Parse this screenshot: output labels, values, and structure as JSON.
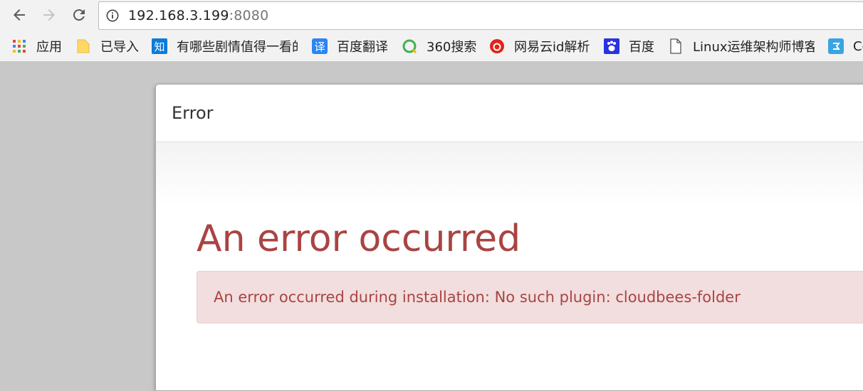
{
  "browser": {
    "url_host": "192.168.3.199",
    "url_port": ":8080",
    "bookmarks": [
      {
        "icon": "apps-grid-icon",
        "label": "应用"
      },
      {
        "icon": "folder-icon",
        "label": "已导入"
      },
      {
        "icon": "zhihu-icon",
        "label": "有哪些剧情值得一看的"
      },
      {
        "icon": "translate-icon",
        "label": "百度翻译"
      },
      {
        "icon": "360-search-icon",
        "label": "360搜索"
      },
      {
        "icon": "netease-cloud-icon",
        "label": "网易云id解析"
      },
      {
        "icon": "baidu-paw-icon",
        "label": "百度"
      },
      {
        "icon": "page-icon",
        "label": "Linux运维架构师博客"
      },
      {
        "icon": "blue-app-icon",
        "label": "Co"
      }
    ],
    "icon_glyphs": {
      "zhihu": "知",
      "translate": "译"
    }
  },
  "dialog": {
    "title": "Error",
    "heading": "An error occurred",
    "message": "An error occurred during installation: No such plugin: cloudbees-folder"
  }
}
